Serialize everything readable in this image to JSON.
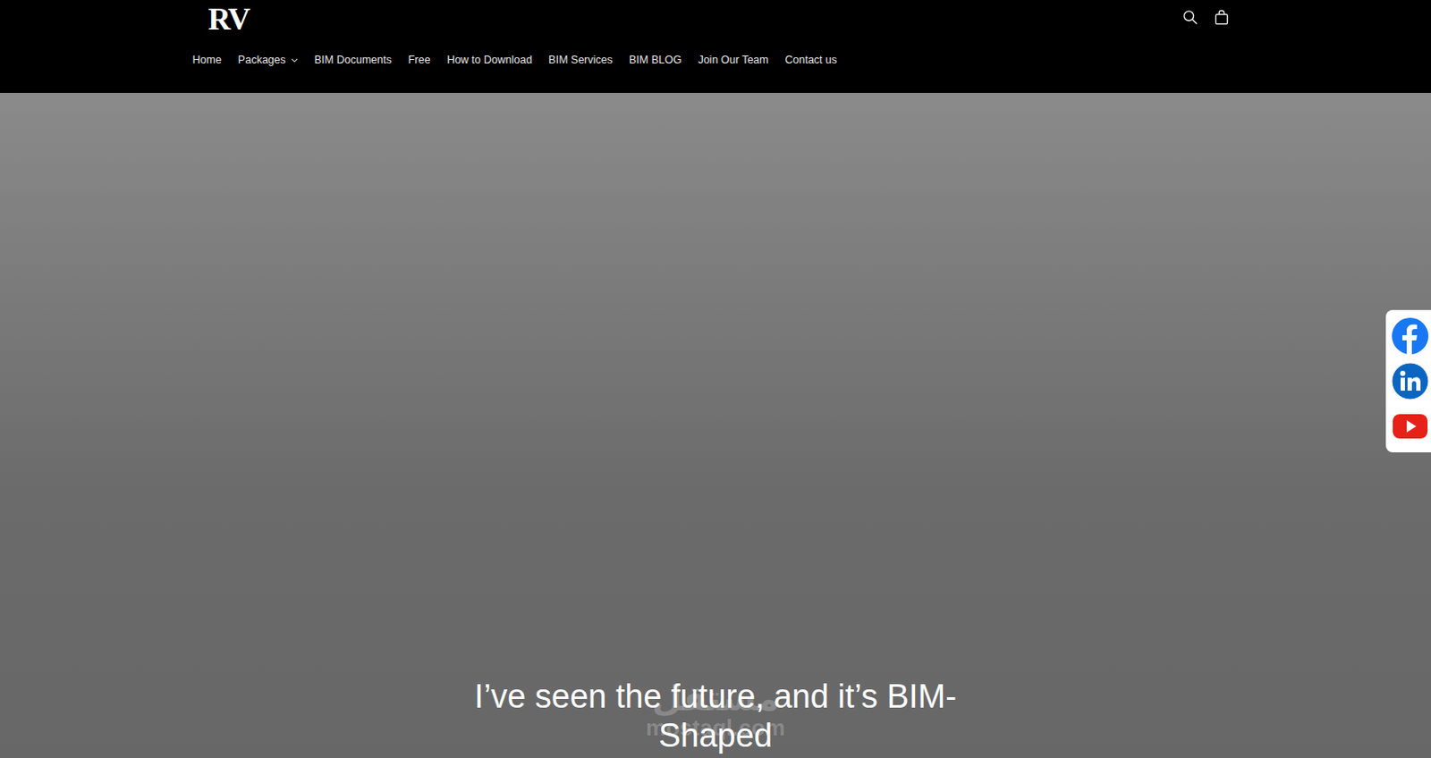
{
  "header": {
    "logo": "RV",
    "nav": [
      {
        "label": "Home",
        "has_dropdown": false
      },
      {
        "label": "Packages",
        "has_dropdown": true
      },
      {
        "label": "BIM Documents",
        "has_dropdown": false
      },
      {
        "label": "Free",
        "has_dropdown": false
      },
      {
        "label": "How to Download",
        "has_dropdown": false
      },
      {
        "label": "BIM Services",
        "has_dropdown": false
      },
      {
        "label": "BIM BLOG",
        "has_dropdown": false
      },
      {
        "label": "Join Our Team",
        "has_dropdown": false
      },
      {
        "label": "Contact us",
        "has_dropdown": false
      }
    ]
  },
  "hero": {
    "heading": "I’ve seen the future, and it’s BIM-Shaped"
  },
  "social": [
    {
      "kind": "facebook",
      "color": "#1877f2"
    },
    {
      "kind": "linkedin",
      "color": "#0a66c2"
    },
    {
      "kind": "youtube",
      "color": "#e62117"
    }
  ],
  "watermark": {
    "arabic": "مستقل",
    "latin": "mostaql.com"
  }
}
